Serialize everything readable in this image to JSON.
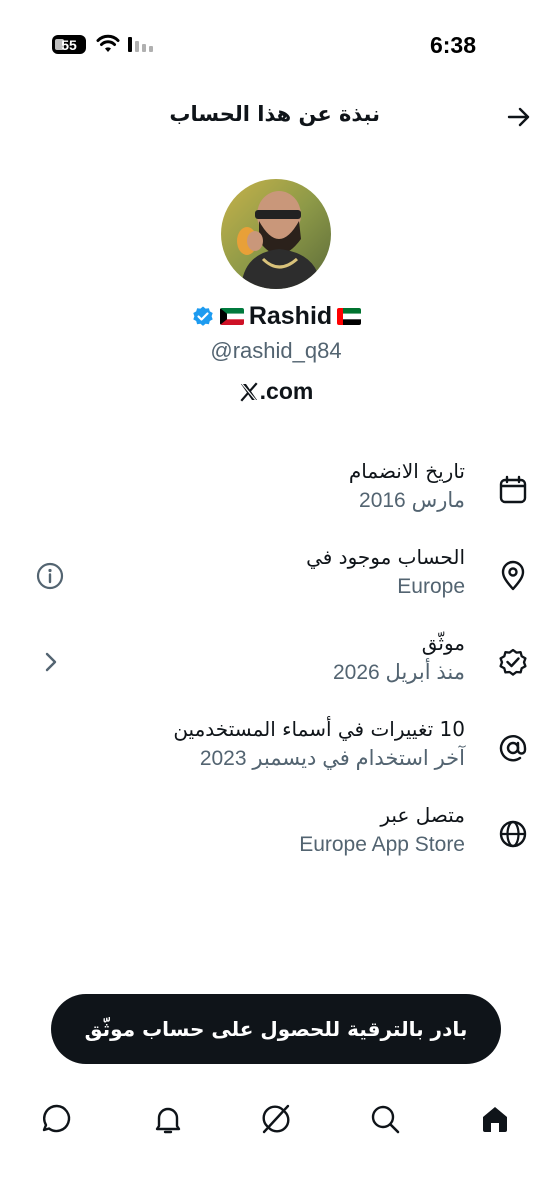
{
  "status_bar": {
    "time": "6:38",
    "battery": "55",
    "icons": [
      "battery-icon",
      "wifi-icon",
      "signal-icon"
    ]
  },
  "header": {
    "title": "نبذة عن هذا الحساب",
    "back_icon": "arrow-right-icon"
  },
  "profile": {
    "name": "Rashid",
    "handle": "@rashid_q84",
    "website_suffix": ".com",
    "website_logo": "x-logo-icon",
    "flags": [
      "kuwait-flag",
      "uae-flag"
    ],
    "verified_color": "#1d9bf0"
  },
  "info": {
    "joined": {
      "title": "تاريخ الانضمام",
      "value": "مارس 2016",
      "icon": "calendar-icon"
    },
    "location": {
      "title": "الحساب موجود في",
      "value": "Europe",
      "icon": "location-pin-icon",
      "side_icon": "info-icon"
    },
    "verified": {
      "title": "موثّق",
      "value": "منذ أبريل 2026",
      "icon": "verified-badge-icon",
      "side_icon": "chevron-left-icon"
    },
    "username_changes": {
      "title": "10 تغييرات في أسماء المستخدمين",
      "value": "آخر استخدام في ديسمبر 2023",
      "icon": "at-sign-icon"
    },
    "connected_via": {
      "title": "متصل عبر",
      "value": "Europe App Store",
      "icon": "globe-icon"
    }
  },
  "upgrade_button": {
    "label": "بادر بالترقية للحصول على حساب موثّق"
  },
  "bottom_nav": [
    "home-icon",
    "search-icon",
    "grok-icon",
    "notifications-icon",
    "messages-icon"
  ],
  "colors": {
    "text": "#0f1419",
    "secondary": "#536471",
    "accent": "#1d9bf0",
    "button_bg": "#0f1419"
  }
}
